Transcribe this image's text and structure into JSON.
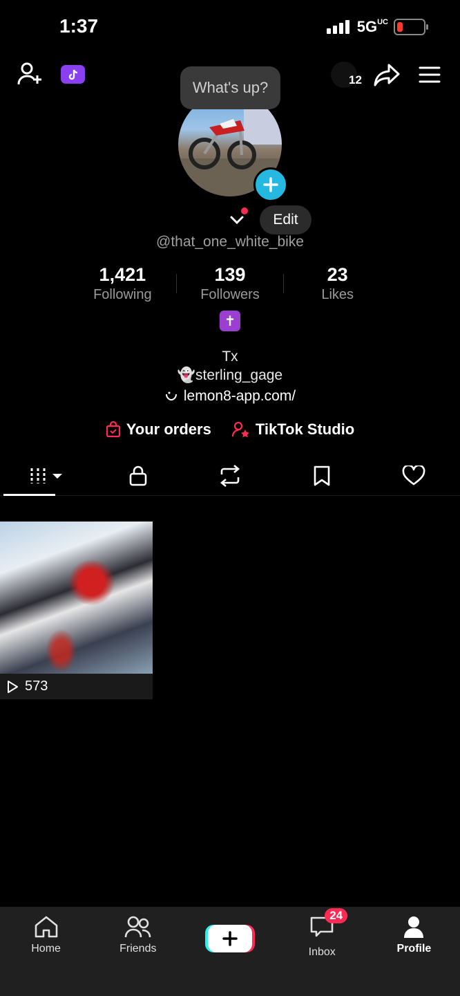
{
  "status_bar": {
    "time": "1:37",
    "network": "5G",
    "network_sub": "UC"
  },
  "top": {
    "notification_count": "12",
    "bubble_text": "What's up?"
  },
  "profile": {
    "edit_label": "Edit",
    "handle": "@that_one_white_bike",
    "stats": [
      {
        "value": "1,421",
        "label": "Following"
      },
      {
        "value": "139",
        "label": "Followers"
      },
      {
        "value": "23",
        "label": "Likes"
      }
    ],
    "badge_symbol": "✝",
    "bio": [
      "Tx",
      "👻sterling_gage",
      "lemon8-app.com/"
    ],
    "links": [
      {
        "label": "Your orders"
      },
      {
        "label": "TikTok Studio"
      }
    ]
  },
  "tabs": [
    "videos-icon",
    "lock-icon",
    "repost-icon",
    "bookmark-icon",
    "heart-icon"
  ],
  "videos": [
    {
      "views": "573"
    }
  ],
  "bottom_nav": {
    "home": "Home",
    "friends": "Friends",
    "inbox": "Inbox",
    "inbox_badge": "24",
    "profile": "Profile"
  },
  "colors": {
    "accent_red": "#fe2c55",
    "accent_cyan": "#25f4ee",
    "add_blue": "#25b8e0",
    "badge_purple": "#9b3fd1"
  }
}
